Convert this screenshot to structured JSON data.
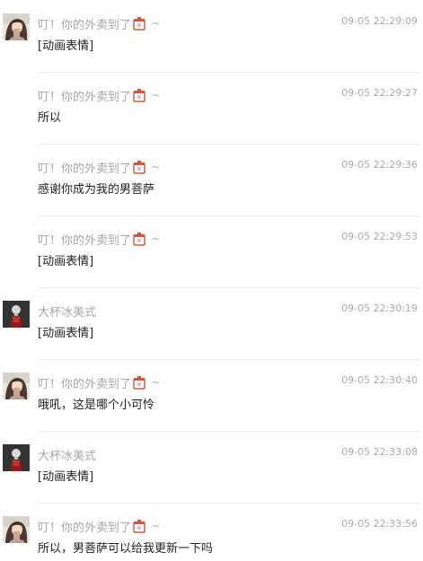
{
  "messages": [
    {
      "sender": "叮！你的外卖到了",
      "sender_suffix": "~",
      "time": "09-05 22:29:09",
      "text": "[动画表情]",
      "avatar": "user-a"
    },
    {
      "sender": "叮！你的外卖到了",
      "sender_suffix": "~",
      "time": "09-05 22:29:27",
      "text": "所以",
      "avatar": "none"
    },
    {
      "sender": "叮！你的外卖到了",
      "sender_suffix": "~",
      "time": "09-05 22:29:36",
      "text": "感谢你成为我的男菩萨",
      "avatar": "none"
    },
    {
      "sender": "叮！你的外卖到了",
      "sender_suffix": "~",
      "time": "09-05 22:29:53",
      "text": "[动画表情]",
      "avatar": "none"
    },
    {
      "sender": "大杯冰美式",
      "sender_suffix": "",
      "time": "09-05 22:30:19",
      "text": "[动画表情]",
      "avatar": "user-b"
    },
    {
      "sender": "叮！你的外卖到了",
      "sender_suffix": "~",
      "time": "09-05 22:30:40",
      "text": "哦吼，这是哪个小可怜",
      "avatar": "user-a"
    },
    {
      "sender": "大杯冰美式",
      "sender_suffix": "",
      "time": "09-05 22:33:08",
      "text": "[动画表情]",
      "avatar": "user-b"
    },
    {
      "sender": "叮！你的外卖到了",
      "sender_suffix": "~",
      "time": "09-05 22:33:56",
      "text": "所以，男菩萨可以给我更新一下吗",
      "avatar": "user-a"
    }
  ],
  "icons": {
    "sender_emoji": "takeout-box-emoji-icon",
    "avatar_user_a": "girl-portrait-avatar",
    "avatar_user_b": "dark-figure-avatar"
  }
}
